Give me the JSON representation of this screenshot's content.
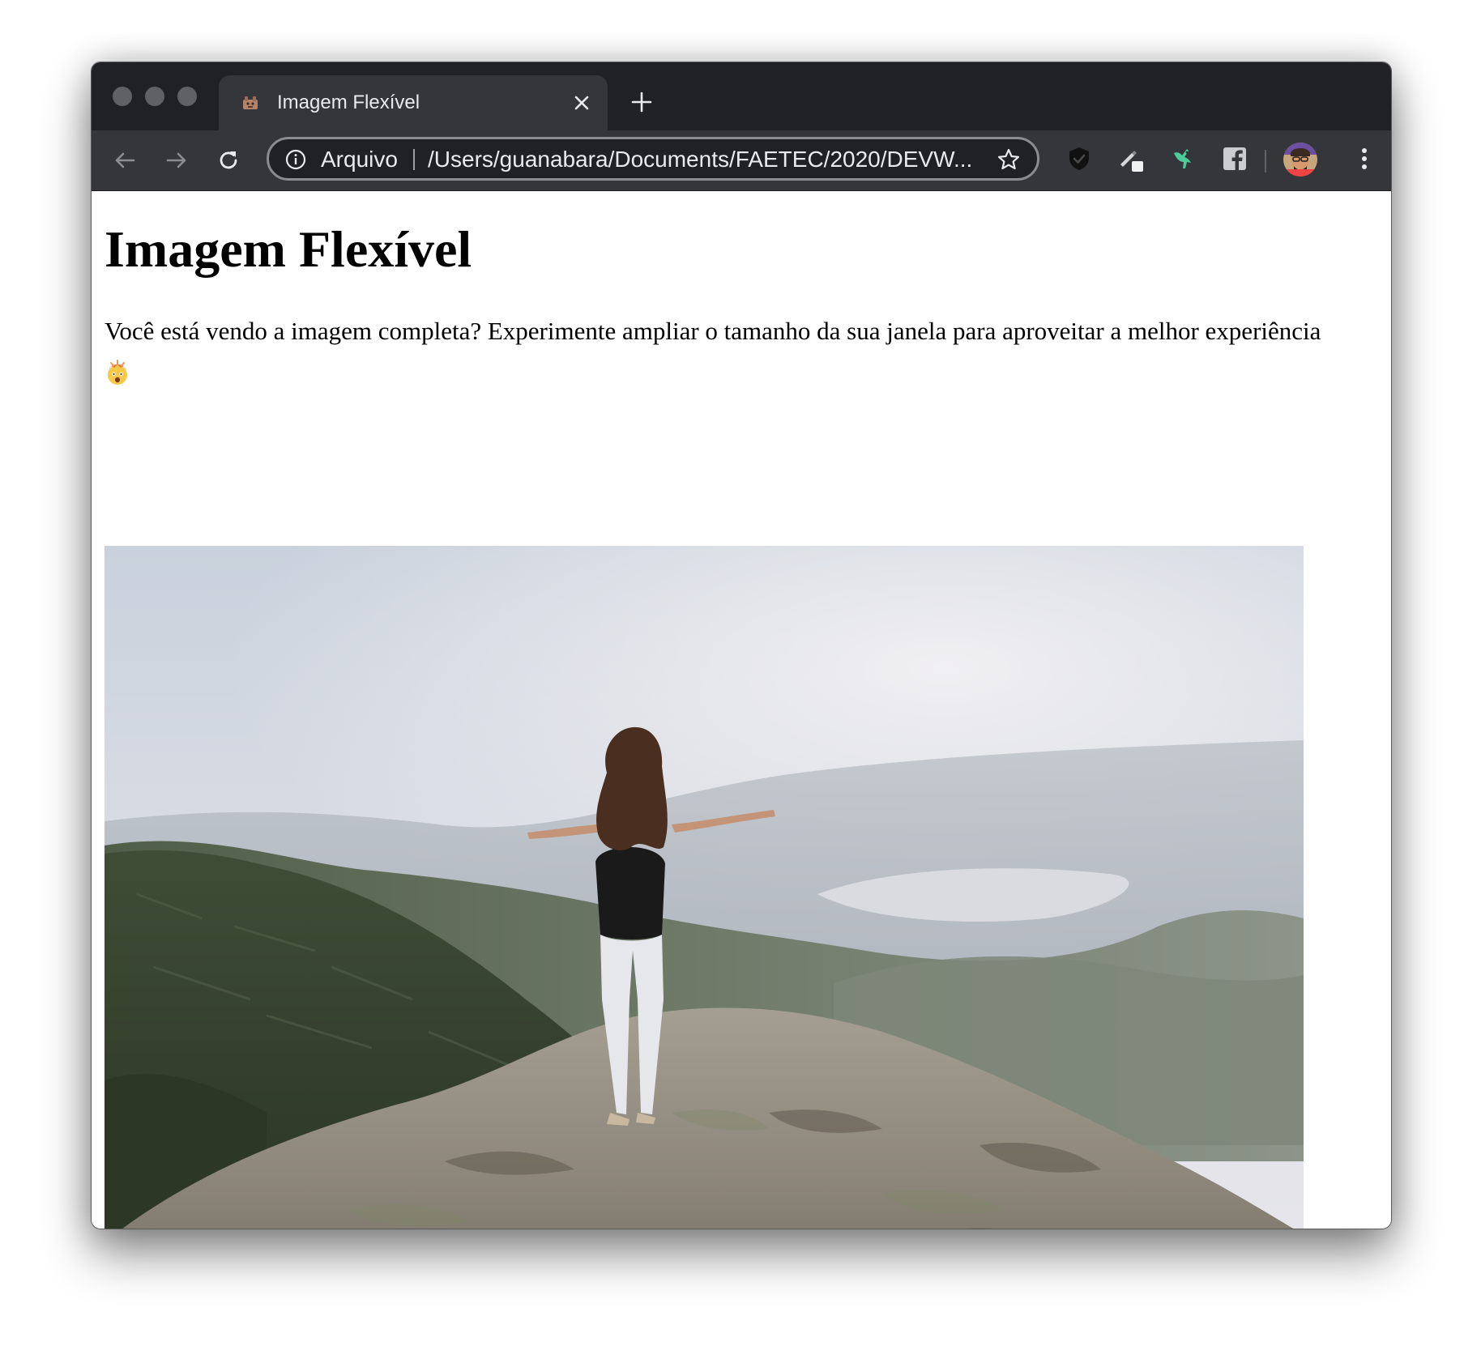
{
  "browser": {
    "tab": {
      "title": "Imagem Flexível"
    },
    "omnibox": {
      "scheme_label": "Arquivo",
      "url": "/Users/guanabara/Documents/FAETEC/2020/DEVW..."
    },
    "icons": {
      "back": "arrow-left",
      "forward": "arrow-right",
      "reload": "reload",
      "info": "info",
      "star": "star",
      "menu": "vertical-dots"
    },
    "extensions": [
      "shield",
      "pen-with-badge",
      "bird",
      "facebook",
      "profile-avatar"
    ]
  },
  "page": {
    "heading": "Imagem Flexível",
    "paragraph": "Você está vendo a imagem completa? Experimente ampliar o tamanho da sua janela para aproveitar a melhor experiência",
    "emoji": "🤯",
    "image": {
      "subject": "mountain-summit-photo"
    }
  }
}
